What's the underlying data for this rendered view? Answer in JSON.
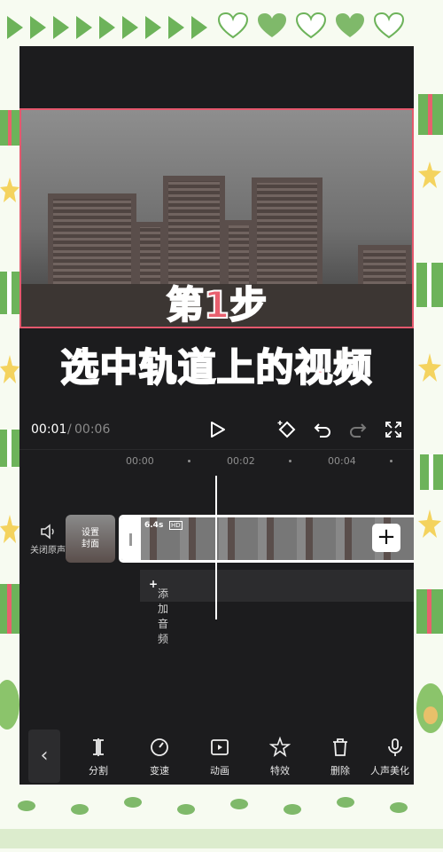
{
  "overlay": {
    "step": "第1步",
    "instruction": "选中轨道上的视频"
  },
  "player": {
    "current_time": "00:01",
    "separator": "/",
    "total_time": "00:06"
  },
  "ruler": {
    "ticks": [
      "00:00",
      "00:02",
      "00:04"
    ]
  },
  "track": {
    "mute_label": "关闭原声",
    "cover_label": "设置\n封面",
    "clip_duration": "6.4s",
    "clip_badge": "HD",
    "add_audio_label": "添加音频"
  },
  "toolbar": {
    "items": [
      {
        "label": "分割",
        "icon": "split-icon"
      },
      {
        "label": "变速",
        "icon": "speed-icon"
      },
      {
        "label": "动画",
        "icon": "animation-icon"
      },
      {
        "label": "特效",
        "icon": "effects-icon"
      },
      {
        "label": "删除",
        "icon": "delete-icon"
      },
      {
        "label": "人声美化",
        "icon": "voice-beautify-icon"
      }
    ]
  },
  "colors": {
    "accent_pink": "#e8606f",
    "frame_green": "#6db35a",
    "editor_bg": "#1c1c1e"
  }
}
